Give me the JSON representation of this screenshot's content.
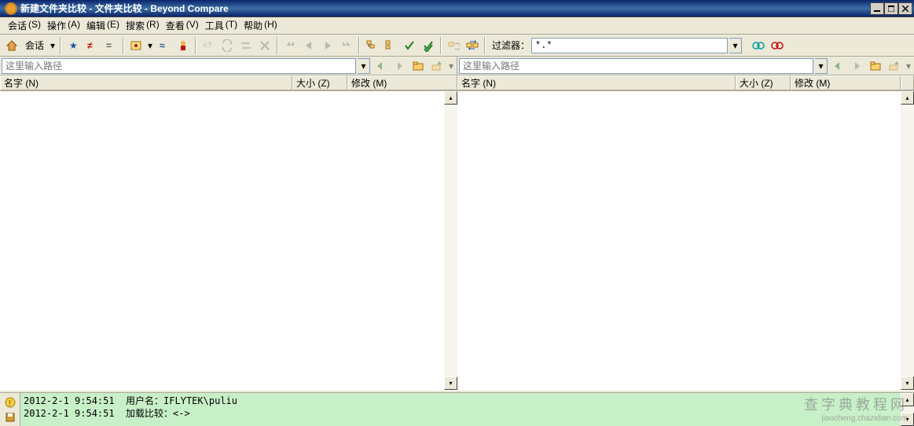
{
  "title": "新建文件夹比较 - 文件夹比较 - Beyond Compare",
  "menu": {
    "session": {
      "label": "会话",
      "accel": "(S)"
    },
    "operate": {
      "label": "操作",
      "accel": "(A)"
    },
    "edit": {
      "label": "编辑",
      "accel": "(E)"
    },
    "search": {
      "label": "搜索",
      "accel": "(R)"
    },
    "view": {
      "label": "查看",
      "accel": "(V)"
    },
    "tools": {
      "label": "工具",
      "accel": "(T)"
    },
    "help": {
      "label": "帮助",
      "accel": "(H)"
    }
  },
  "toolbar": {
    "session_label": "会话",
    "filter_label": "过滤器：",
    "filter_value": "*.*"
  },
  "path": {
    "left_placeholder": "这里输入路径",
    "right_placeholder": "这里输入路径"
  },
  "columns": {
    "name": "名字 (N)",
    "size": "大小 (Z)",
    "modified": "修改 (M)"
  },
  "log": {
    "line1_time": "2012-2-1 9:54:51",
    "line1_text": "用户名：IFLYTEK\\puliu",
    "line2_time": "2012-2-1 9:54:51",
    "line2_text": "加载比较：<->"
  },
  "watermark": {
    "big": "查字典教程网",
    "small": "jiaocheng.chazidian.com"
  }
}
